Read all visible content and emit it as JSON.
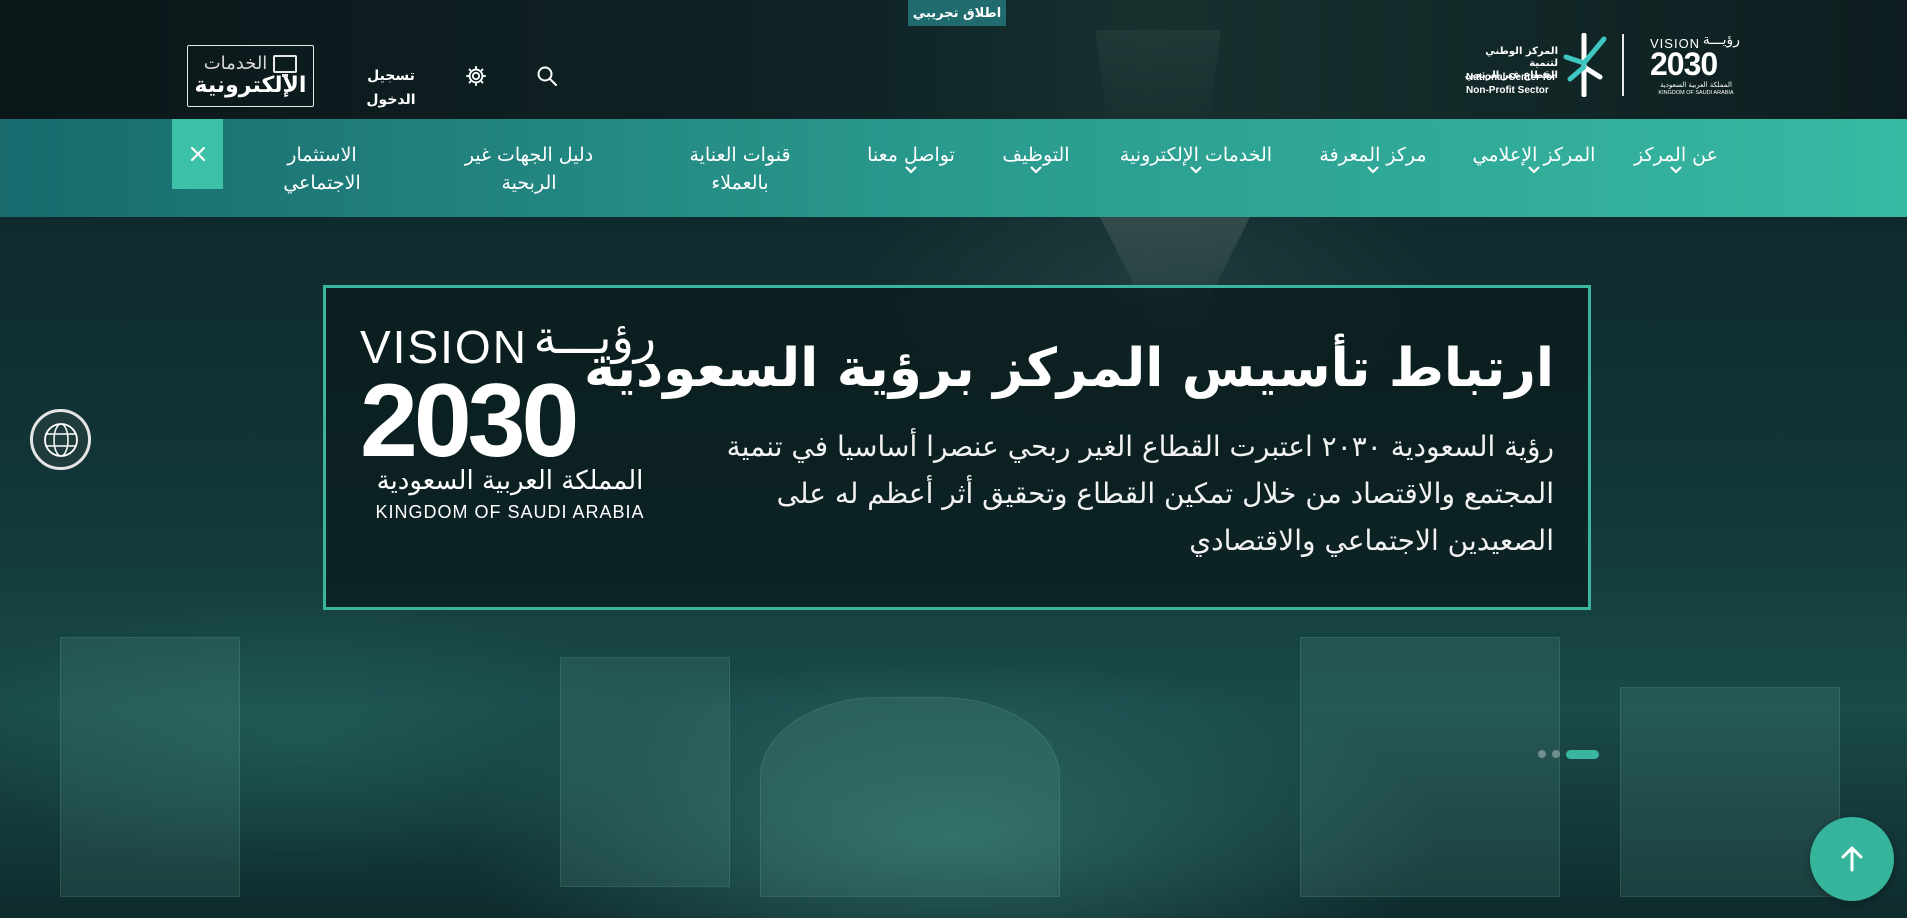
{
  "beta_tag": "اطلاق تجريبي",
  "header": {
    "eservices_logo": {
      "line1": "الخدمات",
      "line2": "الإلكترونية"
    },
    "login_label": "تسجيل الدخول",
    "icons": {
      "settings": "gear-icon",
      "search": "search-icon"
    },
    "center_logo": {
      "ar_line1": "المركز الوطني لتنمية",
      "ar_line2": "القطاع غير الربحي",
      "en_line1": "National Center for",
      "en_line2": "Non-Profit Sector"
    },
    "vision_logo": {
      "vision": "VISION",
      "vision_ar": "رؤيـــة",
      "year": "2030",
      "kingdom_ar": "المملكة العربية السعودية",
      "kingdom_en": "KINGDOM OF SAUDI ARABIA"
    }
  },
  "nav": {
    "items": [
      {
        "label": "عن المركز",
        "has_dropdown": true
      },
      {
        "label": "المركز الإعلامي",
        "has_dropdown": true
      },
      {
        "label": "مركز المعرفة",
        "has_dropdown": true
      },
      {
        "label": "الخدمات الإلكترونية",
        "has_dropdown": true
      },
      {
        "label": "التوظيف",
        "has_dropdown": true
      },
      {
        "label": "تواصل معنا",
        "has_dropdown": true
      },
      {
        "label": "قنوات العناية بالعملاء",
        "has_dropdown": false
      },
      {
        "label": "دليل الجهات غير الربحية",
        "has_dropdown": false
      },
      {
        "label": "الاستثمار الاجتماعي",
        "has_dropdown": false
      }
    ],
    "close_icon": "close-icon"
  },
  "hero": {
    "title": "ارتباط تأسيس المركز برؤية السعودية",
    "text": "رؤية السعودية ٢٠٣٠ اعتبرت القطاع الغير ربحي عنصرا أساسيا في تنمية المجتمع والاقتصاد من خلال تمكين القطاع وتحقيق أثر أعظم له على الصعيدين الاجتماعي والاقتصادي",
    "vision_logo": {
      "vision": "VISION",
      "vision_ar": "رؤيـــة",
      "year": "2030",
      "kingdom_ar": "المملكة العربية السعودية",
      "kingdom_en": "KINGDOM OF SAUDI ARABIA"
    },
    "slides_count": 3,
    "active_slide": 1
  },
  "floating": {
    "accessibility_icon": "globe-icon",
    "scroll_top_icon": "arrow-up-icon"
  },
  "colors": {
    "accent": "#39b69d",
    "nav_gradient_start": "#186a6d",
    "nav_gradient_end": "#37b9a2",
    "header_bg": "#0b1719",
    "beta_tag_bg": "#1f6b6d"
  }
}
